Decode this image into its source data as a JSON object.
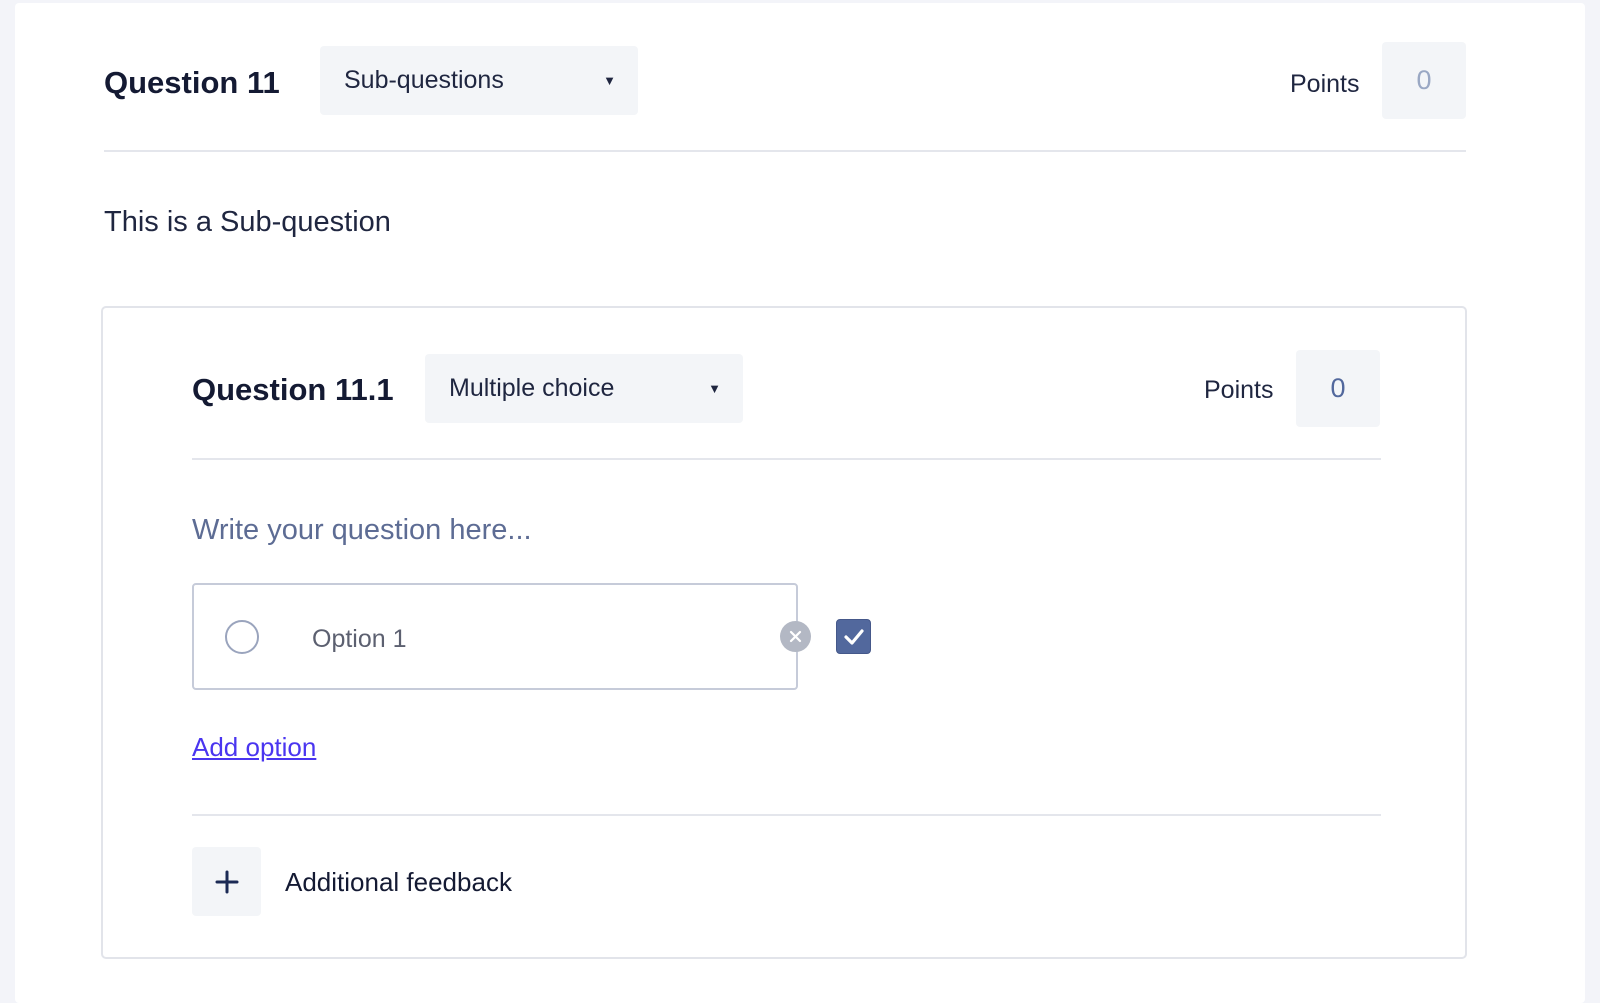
{
  "question": {
    "title": "Question 11",
    "type_selected": "Sub-questions",
    "points_label": "Points",
    "points_value": "0",
    "description": "This is a Sub-question"
  },
  "sub_question": {
    "title": "Question 11.1",
    "type_selected": "Multiple choice",
    "points_label": "Points",
    "points_value": "0",
    "prompt_placeholder": "Write your question here...",
    "options": [
      {
        "text": "Option 1",
        "correct": true
      }
    ],
    "add_option_label": "Add option",
    "additional_feedback_label": "Additional feedback"
  },
  "icons": {
    "dropdown": "chevron-down-icon",
    "remove": "close-icon",
    "correct": "checkmark-icon",
    "add": "plus-icon"
  },
  "colors": {
    "page_background": "#f3f4f9",
    "accent_link": "#4a35f0",
    "checkbox_fill": "#52689d",
    "placeholder_text": "#5d6c94"
  }
}
